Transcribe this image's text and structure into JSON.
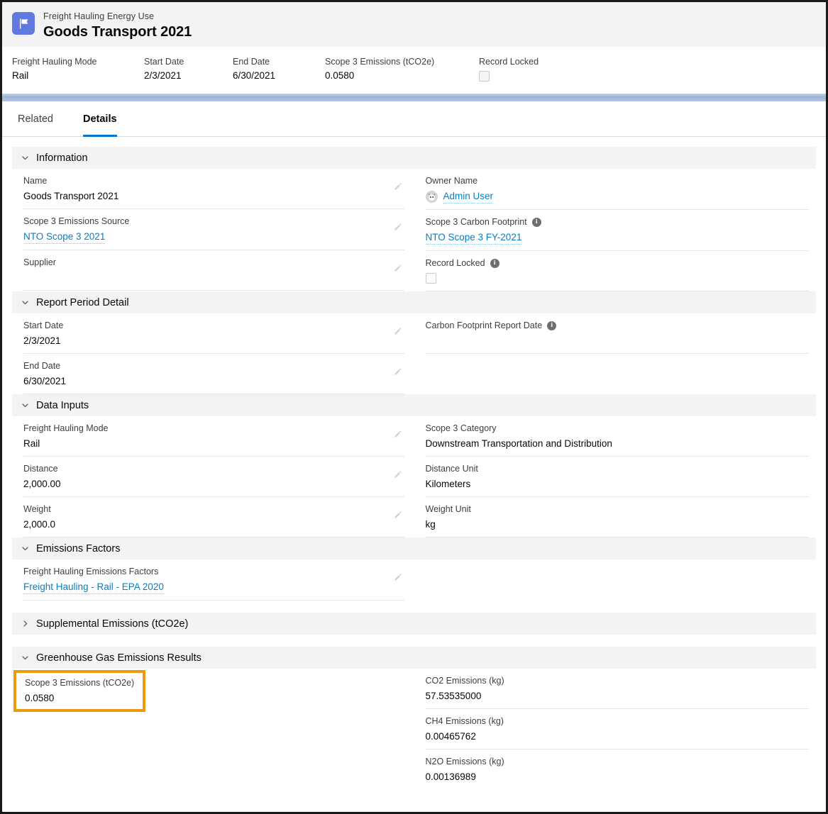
{
  "header": {
    "entity_label": "Freight Hauling Energy Use",
    "record_title": "Goods Transport 2021",
    "icon": "flag-icon",
    "icon_color": "#5f79e0"
  },
  "highlights": [
    {
      "label": "Freight Hauling Mode",
      "value": "Rail",
      "type": "text"
    },
    {
      "label": "Start Date",
      "value": "2/3/2021",
      "type": "text"
    },
    {
      "label": "End Date",
      "value": "6/30/2021",
      "type": "text"
    },
    {
      "label": "Scope 3 Emissions (tCO2e)",
      "value": "0.0580",
      "type": "text"
    },
    {
      "label": "Record Locked",
      "value": "",
      "type": "checkbox"
    }
  ],
  "tabs": [
    {
      "label": "Related",
      "active": false
    },
    {
      "label": "Details",
      "active": true
    }
  ],
  "sections": {
    "information": {
      "title": "Information",
      "expanded": true,
      "left": [
        {
          "label": "Name",
          "value": "Goods Transport 2021",
          "kind": "text",
          "editable": true
        },
        {
          "label": "Scope 3 Emissions Source",
          "value": "NTO Scope 3 2021",
          "kind": "link",
          "editable": true
        },
        {
          "label": "Supplier",
          "value": "",
          "kind": "text",
          "editable": true
        }
      ],
      "right": [
        {
          "label": "Owner Name",
          "value": "Admin User",
          "kind": "owner",
          "info": false
        },
        {
          "label": "Scope 3 Carbon Footprint",
          "value": "NTO Scope 3 FY-2021",
          "kind": "link",
          "info": true
        },
        {
          "label": "Record Locked",
          "value": "",
          "kind": "checkbox",
          "info": true
        }
      ]
    },
    "report_period": {
      "title": "Report Period Detail",
      "expanded": true,
      "left": [
        {
          "label": "Start Date",
          "value": "2/3/2021",
          "kind": "text",
          "editable": true
        },
        {
          "label": "End Date",
          "value": "6/30/2021",
          "kind": "text",
          "editable": true
        }
      ],
      "right": [
        {
          "label": "Carbon Footprint Report Date",
          "value": "",
          "kind": "text",
          "info": true
        }
      ]
    },
    "data_inputs": {
      "title": "Data Inputs",
      "expanded": true,
      "left": [
        {
          "label": "Freight Hauling Mode",
          "value": "Rail",
          "kind": "text",
          "editable": true
        },
        {
          "label": "Distance",
          "value": "2,000.00",
          "kind": "text",
          "editable": true
        },
        {
          "label": "Weight",
          "value": "2,000.0",
          "kind": "text",
          "editable": true
        }
      ],
      "right": [
        {
          "label": "Scope 3 Category",
          "value": "Downstream Transportation and Distribution",
          "kind": "text"
        },
        {
          "label": "Distance Unit",
          "value": "Kilometers",
          "kind": "text"
        },
        {
          "label": "Weight Unit",
          "value": "kg",
          "kind": "text"
        }
      ]
    },
    "emissions_factors": {
      "title": "Emissions Factors",
      "expanded": true,
      "left": [
        {
          "label": "Freight Hauling Emissions Factors",
          "value": "Freight Hauling - Rail - EPA 2020",
          "kind": "link",
          "editable": true
        }
      ],
      "right": []
    },
    "supplemental": {
      "title": "Supplemental Emissions (tCO2e)",
      "expanded": false
    },
    "ghg_results": {
      "title": "Greenhouse Gas Emissions Results",
      "expanded": true,
      "left": [
        {
          "label": "Scope 3 Emissions (tCO2e)",
          "value": "0.0580",
          "kind": "text",
          "highlighted": true
        }
      ],
      "right": [
        {
          "label": "CO2 Emissions (kg)",
          "value": "57.53535000",
          "kind": "text"
        },
        {
          "label": "CH4 Emissions (kg)",
          "value": "0.00465762",
          "kind": "text"
        },
        {
          "label": "N2O Emissions (kg)",
          "value": "0.00136989",
          "kind": "text"
        }
      ]
    }
  },
  "colors": {
    "accent_blue": "#0176d3",
    "link_blue": "#0b7dbd",
    "highlight_orange": "#eb9b10",
    "section_bg": "#f3f3f3",
    "header_bg": "#f3f3f3"
  },
  "icons": {
    "chevron_down": "chevron-down-icon",
    "chevron_right": "chevron-right-icon",
    "pencil": "edit-pencil-icon",
    "info": "info-icon"
  }
}
